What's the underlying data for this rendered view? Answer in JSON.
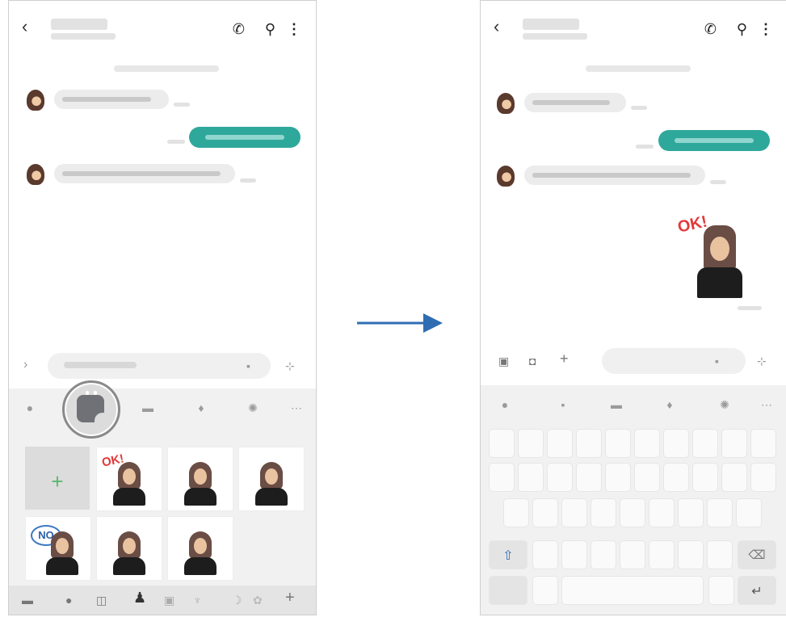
{
  "left_screen": {
    "sticker_burst_text": "OK!",
    "sticker_no_text": "NO"
  },
  "right_screen": {
    "sent_sticker_text": "OK!"
  },
  "icons": {
    "back": "back-arrow-icon",
    "call": "phone-icon",
    "search": "search-icon",
    "more": "more-vertical-icon"
  },
  "colors": {
    "sent_bubble": "#2fa89c",
    "arrow": "#2f6db3"
  }
}
